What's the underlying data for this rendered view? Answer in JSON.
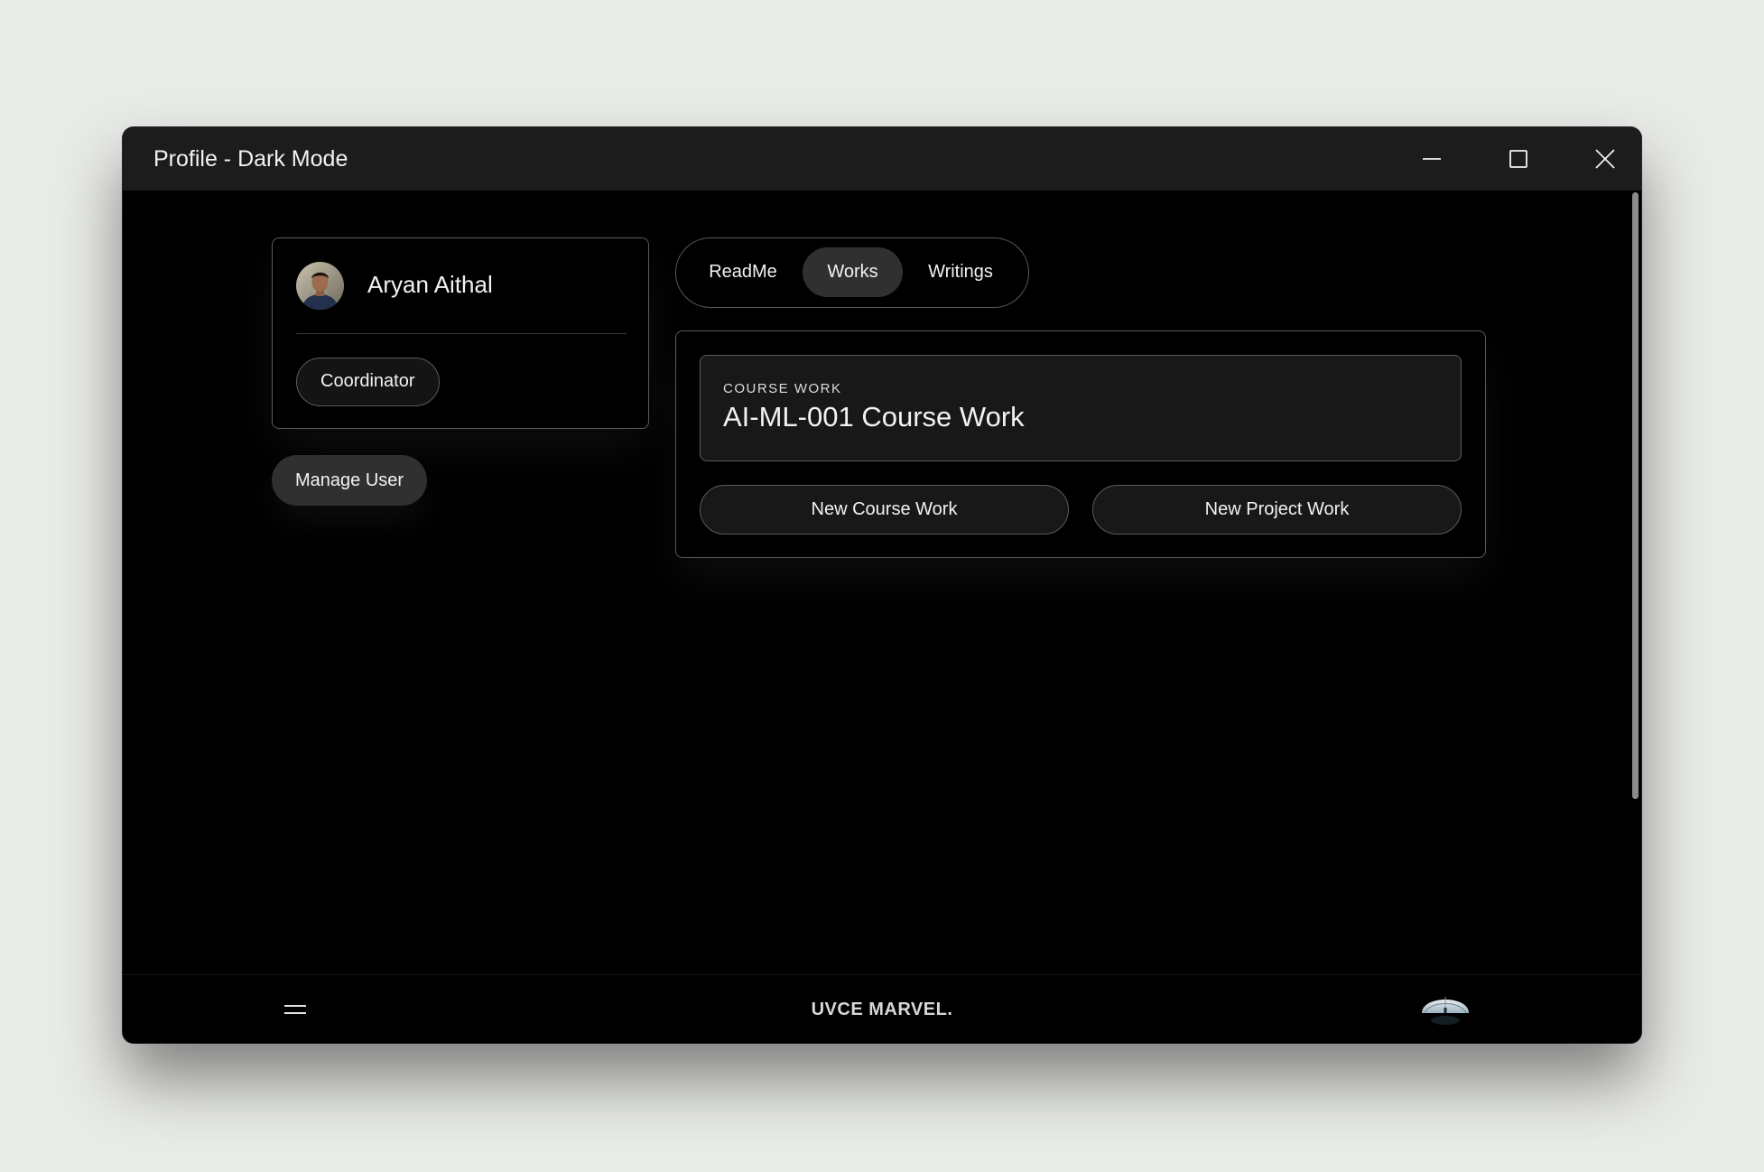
{
  "window": {
    "title": "Profile - Dark Mode",
    "controls": [
      "minimize-icon",
      "maximize-icon",
      "close-icon"
    ]
  },
  "profile": {
    "name": "Aryan Aithal",
    "role": "Coordinator",
    "avatar_icon": "user-avatar-photo"
  },
  "actions": {
    "manage_user": "Manage User"
  },
  "tabs": [
    {
      "label": "ReadMe",
      "active": false
    },
    {
      "label": "Works",
      "active": true
    },
    {
      "label": "Writings",
      "active": false
    }
  ],
  "works": {
    "card": {
      "label": "COURSE WORK",
      "title": "AI-ML-001 Course Work"
    },
    "buttons": {
      "new_course": "New Course Work",
      "new_project": "New Project Work"
    }
  },
  "footer": {
    "menu_icon": "hamburger-menu-icon",
    "brand": "UVCE MARVEL.",
    "avatar_icon": "dome-avatar-image"
  },
  "colors": {
    "background": "#000000",
    "titlebar": "#1c1c1c",
    "border": "#5b5b5b",
    "active_tab": "#303030",
    "text": "#f2f2f2"
  }
}
